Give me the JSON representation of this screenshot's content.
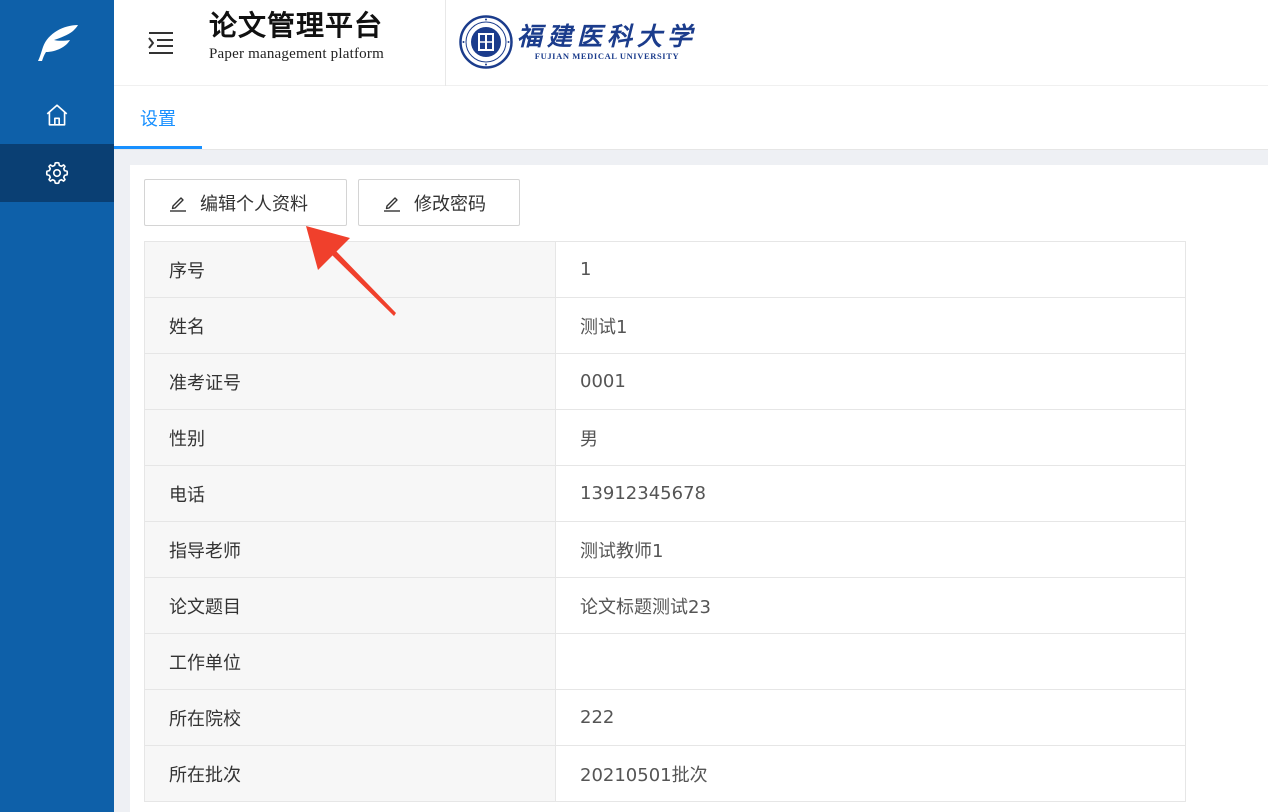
{
  "header": {
    "title": "论文管理平台",
    "subtitle": "Paper management platform",
    "university_cn": "福建医科大学",
    "university_en": "FUJIAN MEDICAL UNIVERSITY"
  },
  "sidebar": {
    "items": [
      {
        "icon": "home-icon",
        "active": false
      },
      {
        "icon": "gear-icon",
        "active": true
      }
    ]
  },
  "tabs": [
    {
      "label": "设置",
      "active": true
    }
  ],
  "toolbar": {
    "edit_profile_label": "编辑个人资料",
    "change_password_label": "修改密码"
  },
  "profile": {
    "rows": [
      {
        "label": "序号",
        "value": "1"
      },
      {
        "label": "姓名",
        "value": "测试1"
      },
      {
        "label": "准考证号",
        "value": "0001"
      },
      {
        "label": "性别",
        "value": "男"
      },
      {
        "label": "电话",
        "value": "13912345678"
      },
      {
        "label": "指导老师",
        "value": "测试教师1"
      },
      {
        "label": "论文题目",
        "value": "论文标题测试23"
      },
      {
        "label": "工作单位",
        "value": ""
      },
      {
        "label": "所在院校",
        "value": "222"
      },
      {
        "label": "所在批次",
        "value": "20210501批次"
      }
    ]
  },
  "colors": {
    "sidebar": "#0e60a9",
    "sidebar_active": "#0a3f73",
    "accent": "#1890ff",
    "annotation_arrow": "#f0402c"
  }
}
